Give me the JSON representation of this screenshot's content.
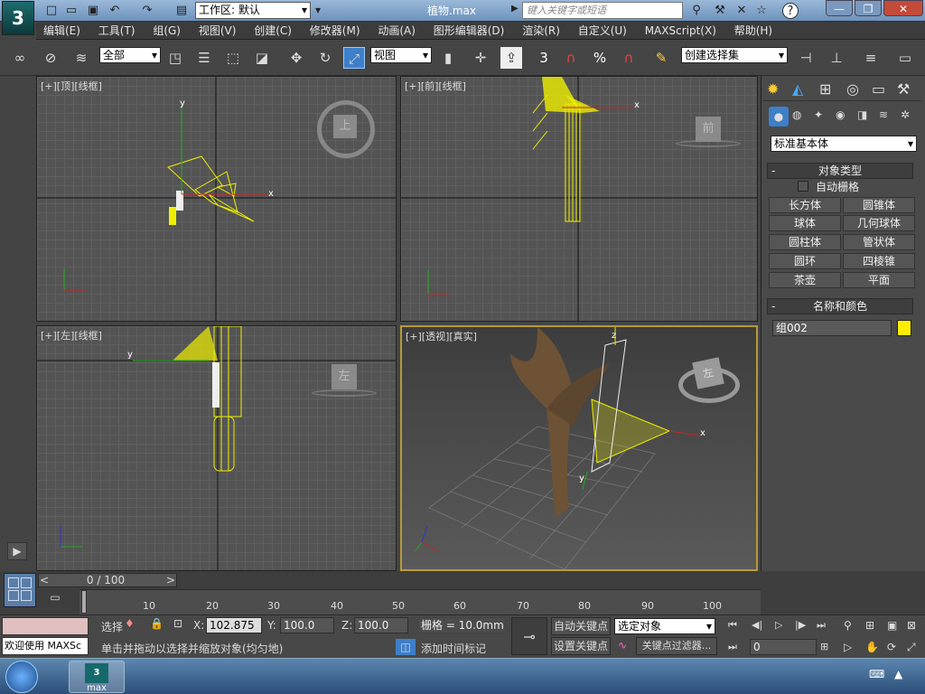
{
  "titlebar": {
    "workspace_label": "工作区: 默认",
    "document": "植物.max",
    "search_placeholder": "键入关键字或短语",
    "logo": "3"
  },
  "menu": [
    "编辑(E)",
    "工具(T)",
    "组(G)",
    "视图(V)",
    "创建(C)",
    "修改器(M)",
    "动画(A)",
    "图形编辑器(D)",
    "渲染(R)",
    "自定义(U)",
    "MAXScript(X)",
    "帮助(H)"
  ],
  "toolbar": {
    "filter": "全部",
    "refcoord": "视图",
    "selection_set": "创建选择集",
    "snap_label": "3",
    "percent": "%"
  },
  "viewports": {
    "top": {
      "label": "[+][顶][线框]",
      "cube": "上"
    },
    "front": {
      "label": "[+][前][线框]",
      "cube": "前"
    },
    "left": {
      "label": "[+][左][线框]",
      "cube": "左"
    },
    "persp": {
      "label": "[+][透视][真实]",
      "cube": "左"
    }
  },
  "axis": {
    "x": "x",
    "y": "y",
    "z": "z"
  },
  "command_panel": {
    "category": "标准基本体",
    "object_type_header": "对象类型",
    "auto_grid": "自动栅格",
    "buttons": [
      "长方体",
      "圆锥体",
      "球体",
      "几何球体",
      "圆柱体",
      "管状体",
      "圆环",
      "四棱锥",
      "茶壶",
      "平面"
    ],
    "name_color_header": "名称和颜色",
    "object_name": "组002",
    "object_color": "#ffee00"
  },
  "timeline": {
    "frame": "0 / 100",
    "ticks": [
      "10",
      "20",
      "30",
      "40",
      "50",
      "60",
      "70",
      "80",
      "90",
      "100"
    ]
  },
  "status": {
    "listener": "欢迎使用 MAXSc",
    "select_label": "选择",
    "x_label": "X:",
    "x": "102.875",
    "y_label": "Y:",
    "y": "100.0",
    "z_label": "Z:",
    "z": "100.0",
    "grid": "栅格 = 10.0mm",
    "autokey": "自动关键点",
    "setkey": "设置关键点",
    "key_mode": "选定对象",
    "key_filters": "关键点过滤器...",
    "frame_field": "0",
    "prompt": "单击并拖动以选择并缩放对象(均匀地)",
    "add_time_tag": "添加时间标记"
  },
  "taskbar": {
    "app": "max"
  }
}
